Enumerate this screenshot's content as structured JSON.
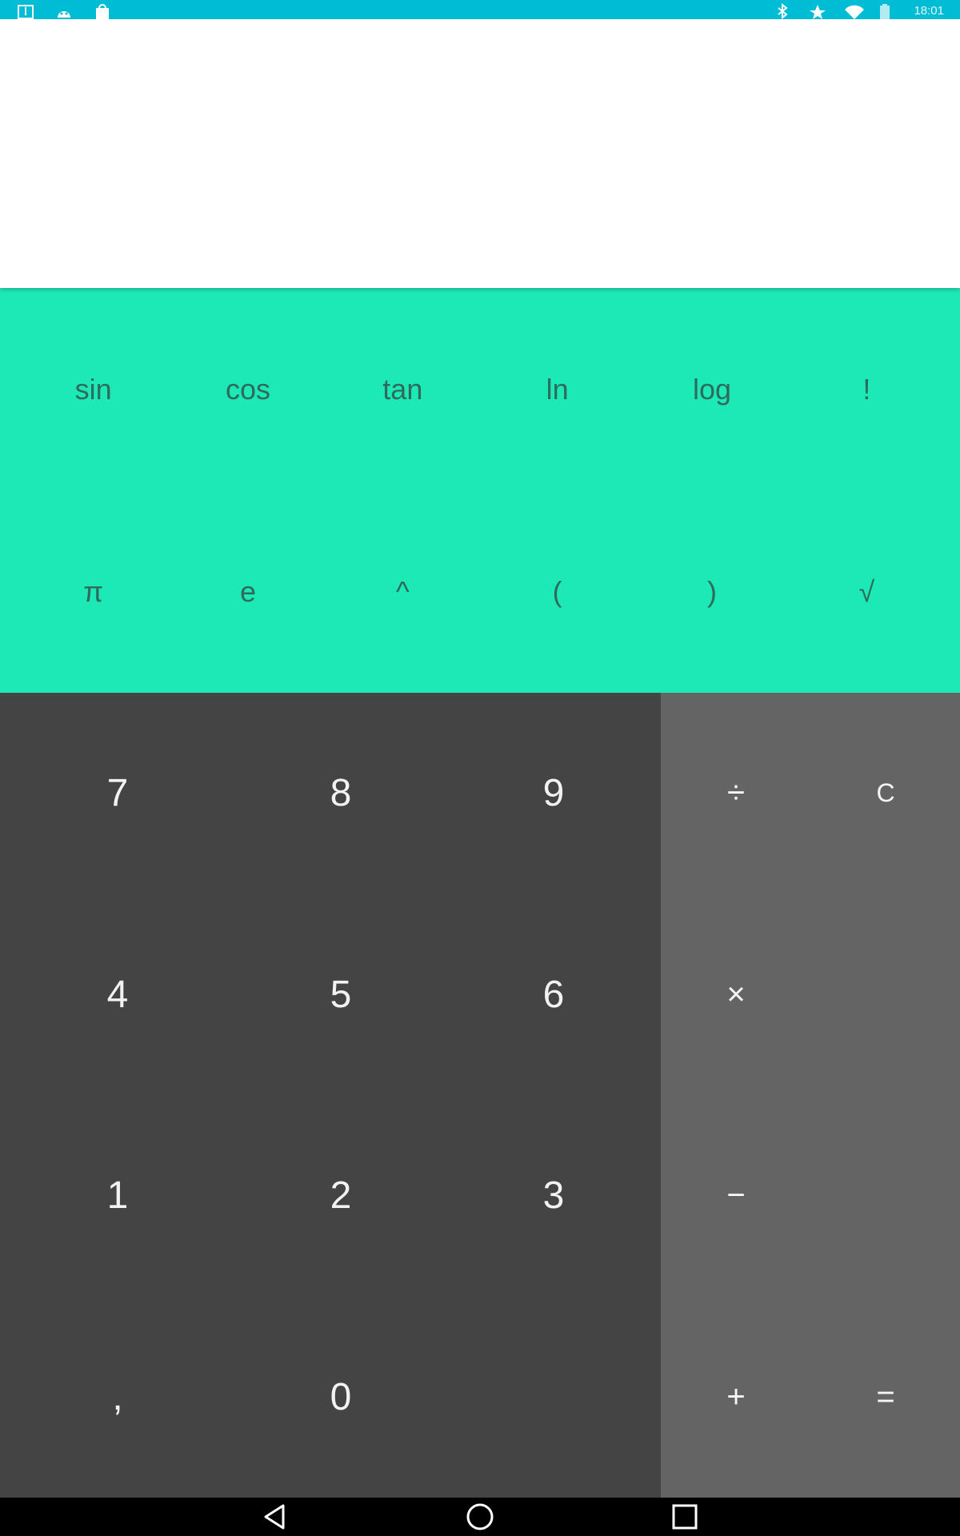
{
  "status_bar": {
    "clock": "18:01",
    "left_icons": [
      "screenshot-icon",
      "android-icon",
      "shopping-bag-icon"
    ],
    "right_icons": [
      "bluetooth-icon",
      "star-icon",
      "wifi-icon",
      "battery-icon"
    ],
    "color": "#00bcd4"
  },
  "display": {
    "formula": ""
  },
  "advanced": {
    "color": "#1de9b6",
    "row1": [
      "sin",
      "cos",
      "tan",
      "ln",
      "log",
      "!"
    ],
    "row2": [
      "π",
      "e",
      "^",
      "(",
      ")",
      "√"
    ]
  },
  "numpad": {
    "color": "#444444",
    "keys": [
      "7",
      "8",
      "9",
      "4",
      "5",
      "6",
      "1",
      "2",
      "3",
      ",",
      "0",
      ""
    ]
  },
  "operators": {
    "color": "#646464",
    "divide": "÷",
    "clear": "C",
    "multiply": "×",
    "subtract": "−",
    "add": "+",
    "equals": "="
  },
  "navbar": {
    "icons": [
      "back-icon",
      "home-icon",
      "recents-icon"
    ]
  }
}
